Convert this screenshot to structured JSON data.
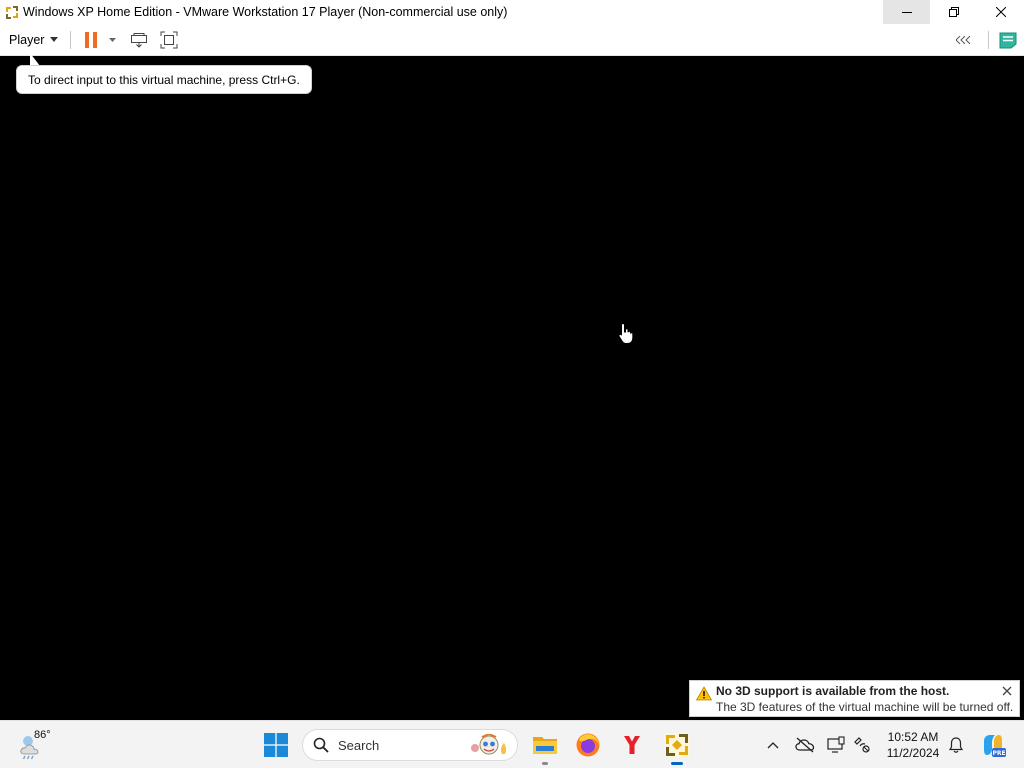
{
  "window": {
    "title": "Windows XP Home Edition - VMware Workstation 17 Player (Non-commercial use only)",
    "controls": [
      "minimize-icon",
      "restore-icon",
      "close-icon"
    ]
  },
  "toolbar": {
    "player_label": "Player",
    "buttons": [
      "pause-icon",
      "dropdown-arrow-icon",
      "send-ctrl-alt-del-icon",
      "full-screen-icon"
    ],
    "right_buttons": [
      "collapse-icon",
      "unity-icon"
    ],
    "pause_color": "#f06a22"
  },
  "tooltip": {
    "text": "To direct input to this virtual machine, press Ctrl+G."
  },
  "vm": {
    "screen_color": "#000000"
  },
  "notification": {
    "title": "No 3D support is available from the host.",
    "body": "The 3D features of the virtual machine will be turned off."
  },
  "taskbar": {
    "weather_temp": "86°",
    "search_placeholder": "Search",
    "apps": [
      "file-explorer-icon",
      "firefox-icon",
      "yandex-browser-icon",
      "vmware-player-icon"
    ],
    "tray": [
      "chevron-up-icon",
      "onedrive-offline-icon",
      "display-icon",
      "network-icon",
      "notification-bell-icon",
      "copilot-icon"
    ],
    "clock_time": "10:52 AM",
    "clock_date": "11/2/2024",
    "accent": "#0067c0"
  }
}
